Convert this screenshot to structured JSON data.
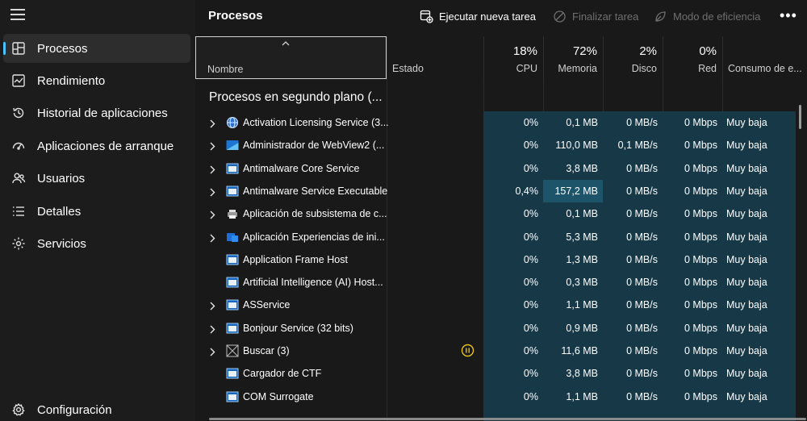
{
  "sidebar": {
    "items": [
      {
        "label": "Procesos",
        "icon": "processes-icon",
        "active": true
      },
      {
        "label": "Rendimiento",
        "icon": "performance-icon"
      },
      {
        "label": "Historial de aplicaciones",
        "icon": "app-history-icon"
      },
      {
        "label": "Aplicaciones de arranque",
        "icon": "startup-apps-icon"
      },
      {
        "label": "Usuarios",
        "icon": "users-icon"
      },
      {
        "label": "Detalles",
        "icon": "details-icon"
      },
      {
        "label": "Servicios",
        "icon": "services-icon"
      }
    ],
    "settings_label": "Configuración"
  },
  "header": {
    "title": "Procesos",
    "run_new_task": "Ejecutar nueva tarea",
    "end_task": "Finalizar tarea",
    "efficiency_mode": "Modo de eficiencia",
    "more": "•••"
  },
  "columns": {
    "name": "Nombre",
    "status": "Estado",
    "cpu": {
      "pct": "18%",
      "label": "CPU"
    },
    "memory": {
      "pct": "72%",
      "label": "Memoria"
    },
    "disk": {
      "pct": "2%",
      "label": "Disco"
    },
    "network": {
      "pct": "0%",
      "label": "Red"
    },
    "power": {
      "label": "Consumo de e..."
    }
  },
  "section_title": "Procesos en segundo plano (...",
  "processes": [
    {
      "name": "Activation Licensing Service (3...",
      "icon": "globe-icon",
      "expandable": true,
      "cpu": "0%",
      "memory": "0,1 MB",
      "disk": "0 MB/s",
      "network": "0 Mbps",
      "power": "Muy baja"
    },
    {
      "name": "Administrador de WebView2 (...",
      "icon": "webview-icon",
      "expandable": true,
      "cpu": "0%",
      "memory": "110,0 MB",
      "disk": "0,1 MB/s",
      "network": "0 Mbps",
      "power": "Muy baja"
    },
    {
      "name": "Antimalware Core Service",
      "icon": "window-icon",
      "expandable": true,
      "cpu": "0%",
      "memory": "3,8 MB",
      "disk": "0 MB/s",
      "network": "0 Mbps",
      "power": "Muy baja"
    },
    {
      "name": "Antimalware Service Executable",
      "icon": "window-icon",
      "expandable": true,
      "cpu": "0,4%",
      "memory": "157,2 MB",
      "disk": "0 MB/s",
      "network": "0 Mbps",
      "power": "Muy baja",
      "highlight_memory": true
    },
    {
      "name": "Aplicación de subsistema de c...",
      "icon": "printer-icon",
      "expandable": true,
      "cpu": "0%",
      "memory": "0,1 MB",
      "disk": "0 MB/s",
      "network": "0 Mbps",
      "power": "Muy baja"
    },
    {
      "name": "Aplicación Experiencias de ini...",
      "icon": "experience-icon",
      "expandable": true,
      "cpu": "0%",
      "memory": "5,3 MB",
      "disk": "0 MB/s",
      "network": "0 Mbps",
      "power": "Muy baja"
    },
    {
      "name": "Application Frame Host",
      "icon": "window-icon",
      "expandable": false,
      "cpu": "0%",
      "memory": "1,3 MB",
      "disk": "0 MB/s",
      "network": "0 Mbps",
      "power": "Muy baja"
    },
    {
      "name": "Artificial Intelligence (AI) Host...",
      "icon": "window-icon",
      "expandable": false,
      "cpu": "0%",
      "memory": "0,3 MB",
      "disk": "0 MB/s",
      "network": "0 Mbps",
      "power": "Muy baja"
    },
    {
      "name": "ASService",
      "icon": "window-icon",
      "expandable": true,
      "cpu": "0%",
      "memory": "1,1 MB",
      "disk": "0 MB/s",
      "network": "0 Mbps",
      "power": "Muy baja"
    },
    {
      "name": "Bonjour Service (32 bits)",
      "icon": "window-icon",
      "expandable": true,
      "cpu": "0%",
      "memory": "0,9 MB",
      "disk": "0 MB/s",
      "network": "0 Mbps",
      "power": "Muy baja"
    },
    {
      "name": "Buscar (3)",
      "icon": "search-app-icon",
      "expandable": true,
      "suspended": true,
      "cpu": "0%",
      "memory": "11,6 MB",
      "disk": "0 MB/s",
      "network": "0 Mbps",
      "power": "Muy baja"
    },
    {
      "name": "Cargador de CTF",
      "icon": "window-icon",
      "expandable": false,
      "cpu": "0%",
      "memory": "3,8 MB",
      "disk": "0 MB/s",
      "network": "0 Mbps",
      "power": "Muy baja"
    },
    {
      "name": "COM Surrogate",
      "icon": "window-icon",
      "expandable": false,
      "cpu": "0%",
      "memory": "1,1 MB",
      "disk": "0 MB/s",
      "network": "0 Mbps",
      "power": "Muy baja"
    }
  ],
  "colors": {
    "accent": "#4cc2ff",
    "metric_bg": "#163847",
    "metric_highlight": "#1e5469",
    "suspended": "#e8c21a"
  }
}
